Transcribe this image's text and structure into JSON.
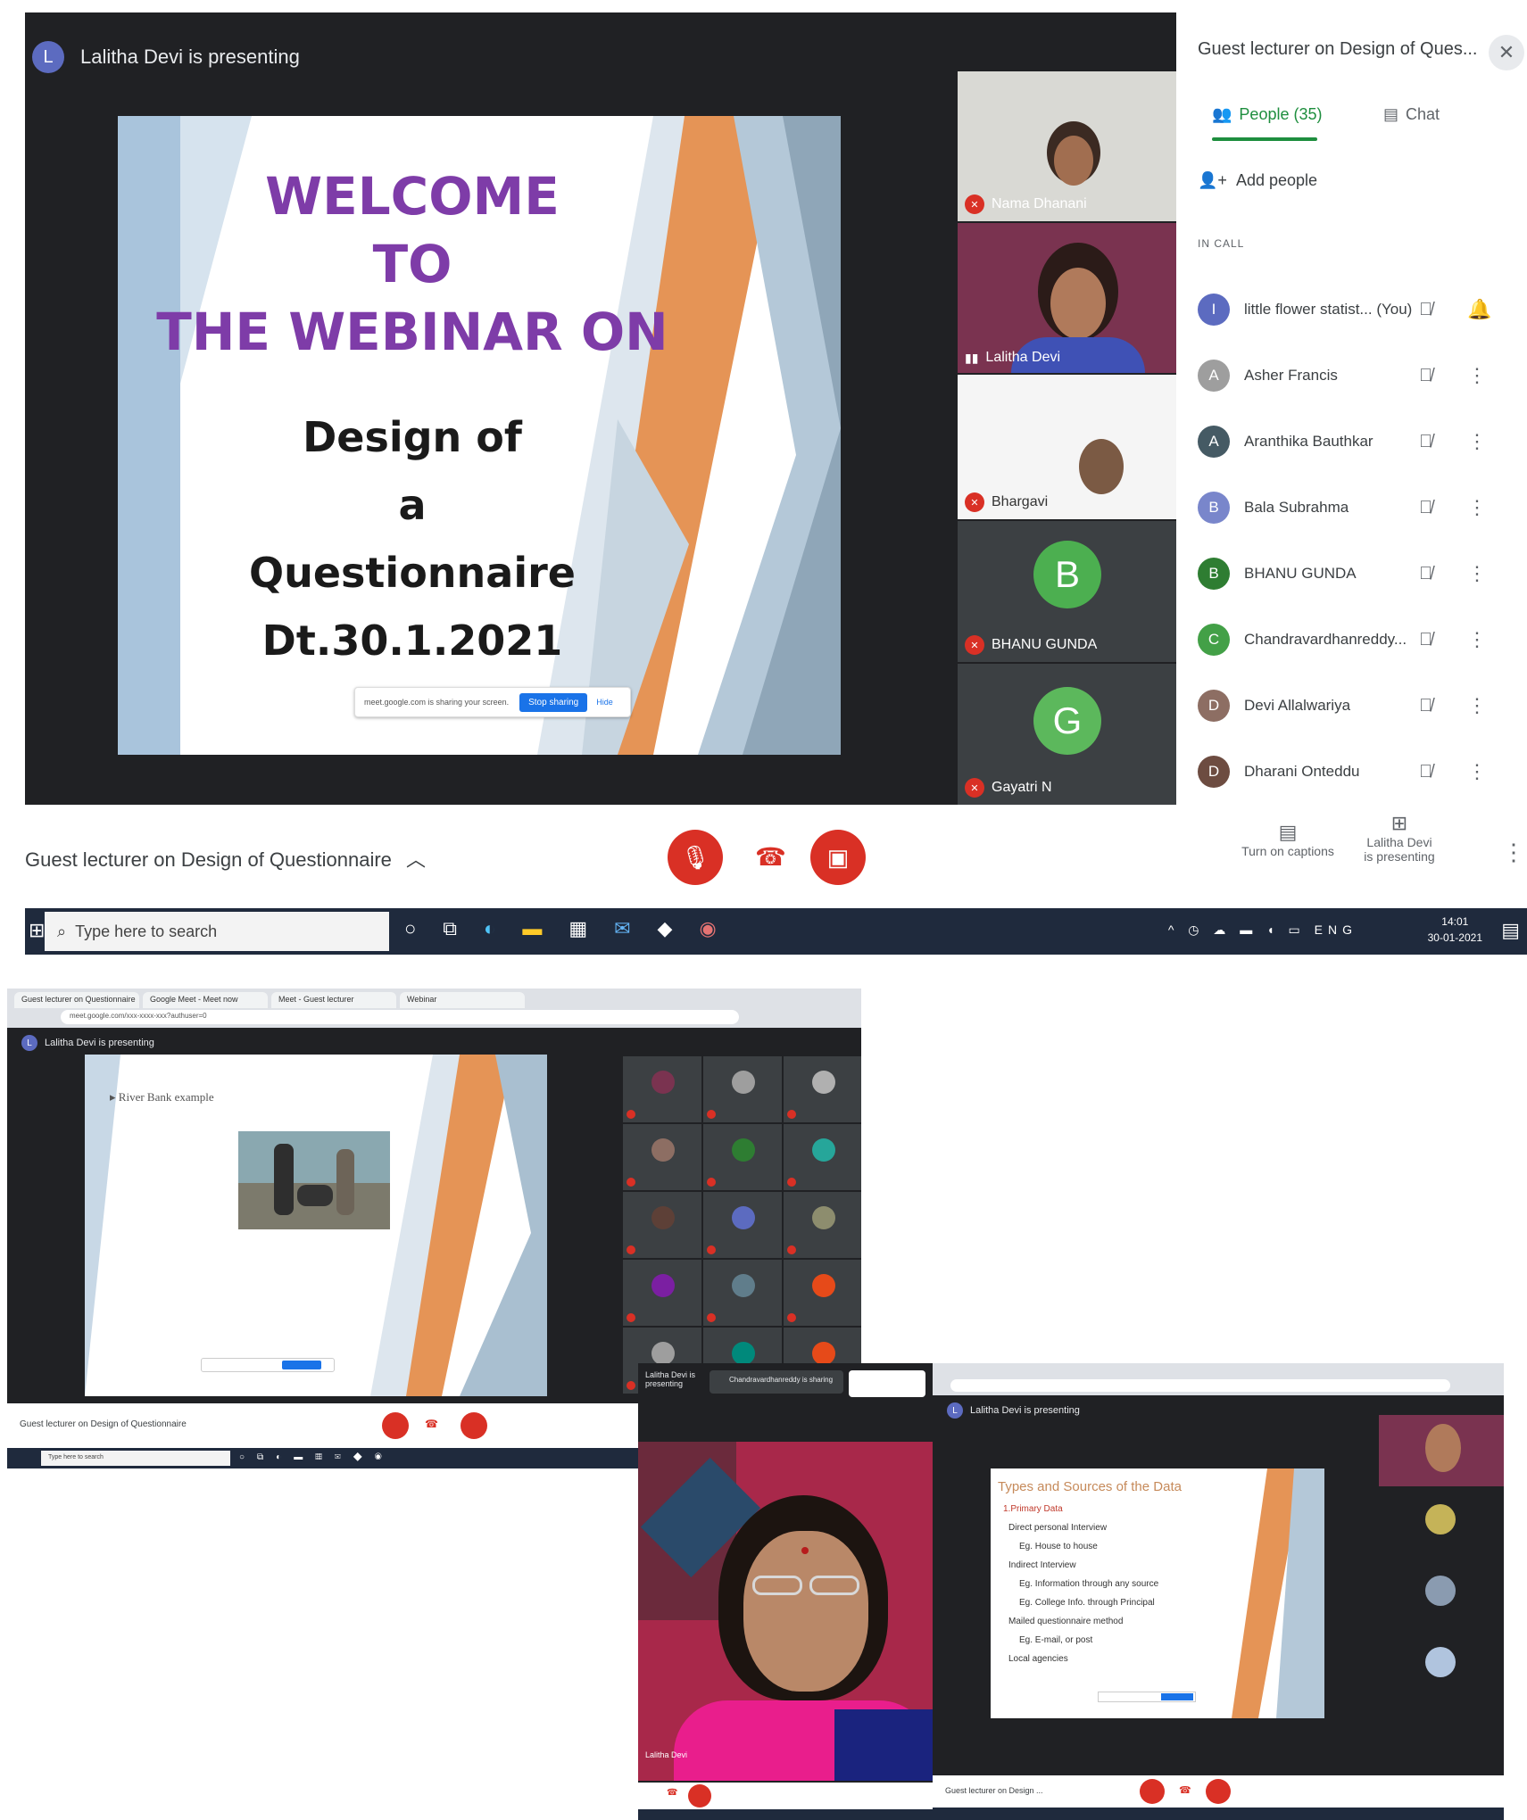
{
  "shot1": {
    "presenter_initial": "L",
    "presenter_text": "Lalitha Devi is presenting",
    "slide": {
      "welcome_line1": "WELCOME",
      "welcome_line2": "TO",
      "welcome_line3": "THE WEBINAR ON",
      "line4": "Design of",
      "line5": "a",
      "line6": "Questionnaire",
      "line7": "Dt.30.1.2021",
      "share_text": "meet.google.com is sharing your screen.",
      "share_button": "Stop sharing",
      "hide_label": "Hide"
    },
    "tiles": [
      {
        "name": "Nama Dhanani"
      },
      {
        "name": "Lalitha Devi"
      },
      {
        "name": "Bhargavi"
      },
      {
        "name": "BHANU GUNDA",
        "initial": "B"
      },
      {
        "name": "Gayatri N",
        "initial": "G"
      }
    ],
    "panel": {
      "title": "Guest lecturer on Design of Ques...",
      "close": "✕",
      "tab_people": "People (35)",
      "tab_chat": "Chat",
      "add_people": "Add people",
      "in_call_label": "IN CALL",
      "people": [
        {
          "initial": "I",
          "name": "little flower statist... (You)",
          "color": "#5c6bc0",
          "action": "🔔"
        },
        {
          "initial": "A",
          "name": "Asher Francis",
          "color": "#9e9e9e",
          "action": "⋮"
        },
        {
          "initial": "A",
          "name": "Aranthika Bauthkar",
          "color": "#455a64",
          "action": "⋮"
        },
        {
          "initial": "B",
          "name": "Bala Subrahma",
          "color": "#7986cb",
          "action": "⋮"
        },
        {
          "initial": "B",
          "name": "BHANU GUNDA",
          "color": "#2e7d32",
          "action": "⋮"
        },
        {
          "initial": "C",
          "name": "Chandravardhanreddy...",
          "color": "#43a047",
          "action": "⋮"
        },
        {
          "initial": "D",
          "name": "Devi Allalwariya",
          "color": "#8d6e63",
          "action": "⋮"
        },
        {
          "initial": "D",
          "name": "Dharani Onteddu",
          "color": "#6d4c41",
          "action": "⋮"
        }
      ]
    },
    "bottom": {
      "meeting_title": "Guest lecturer on Design of Questionnaire",
      "captions_label": "Turn on captions",
      "presenting_label_1": "Lalitha Devi",
      "presenting_label_2": "is presenting"
    },
    "taskbar": {
      "search_placeholder": "Type here to search",
      "time": "14:01",
      "date": "30-01-2021",
      "lang": "ENG"
    }
  },
  "shot2": {
    "tabs": [
      "Guest lecturer on Questionnaire",
      "Google Meet - Meet now",
      "Meet - Guest lecturer",
      "Webinar"
    ],
    "url": "meet.google.com/xxx-xxxx-xxx?authuser=0",
    "presenter_text": "Lalitha Devi is presenting",
    "slide_bullet": "River Bank example",
    "meeting_title": "Guest lecturer on Design of Questionnaire",
    "taskbar_search": "Type here to search"
  },
  "shot3": {
    "presenting_label": "Lalitha Devi is presenting",
    "tile_label": "Chandravardhanreddy is sharing",
    "speaker_name": "Lalitha Devi"
  },
  "shot4": {
    "presenter_text": "Lalitha Devi is presenting",
    "slide_title": "Types and Sources of the Data",
    "bullets": [
      "1.Primary Data",
      "Direct personal Interview",
      "Eg. House to house",
      "Indirect Interview",
      "Eg. Information through any source",
      "Eg. College Info. through Principal",
      "Mailed questionnaire method",
      "Eg. E-mail, or post",
      "Local agencies"
    ],
    "meeting_title": "Guest lecturer on Design ..."
  }
}
